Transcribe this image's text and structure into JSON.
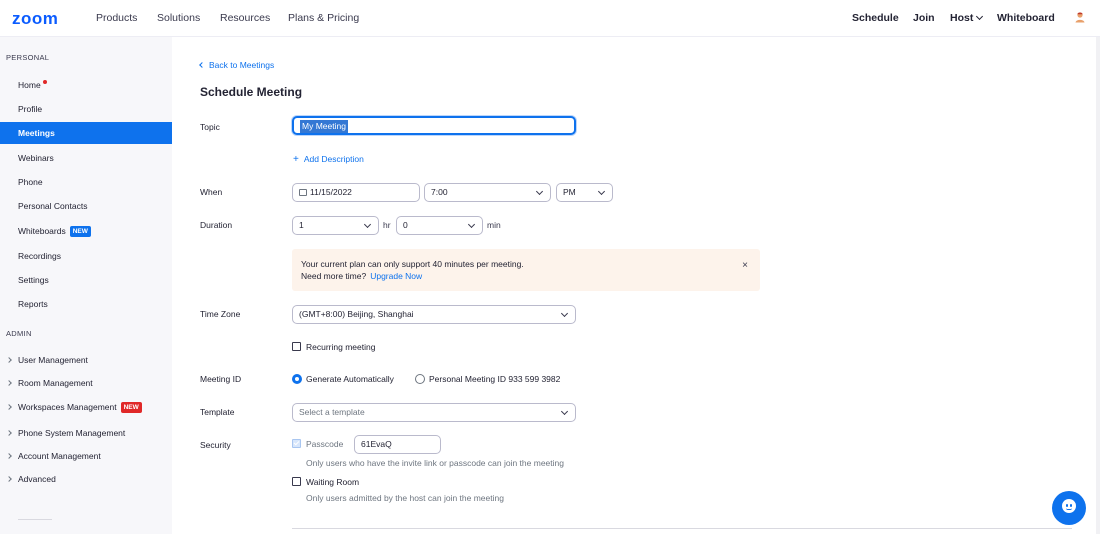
{
  "brand": {
    "logo": "zoom",
    "accent": "#0e72ed"
  },
  "topnav": {
    "links": [
      "Products",
      "Solutions",
      "Resources",
      "Plans & Pricing"
    ],
    "right": {
      "schedule": "Schedule",
      "join": "Join",
      "host": "Host",
      "whiteboard": "Whiteboard"
    }
  },
  "sidebar": {
    "personal_title": "PERSONAL",
    "items": [
      {
        "label": "Home",
        "dot": true
      },
      {
        "label": "Profile"
      },
      {
        "label": "Meetings",
        "active": true
      },
      {
        "label": "Webinars"
      },
      {
        "label": "Phone"
      },
      {
        "label": "Personal Contacts"
      },
      {
        "label": "Whiteboards",
        "badge": "NEW"
      },
      {
        "label": "Recordings"
      },
      {
        "label": "Settings"
      },
      {
        "label": "Reports"
      }
    ],
    "admin_title": "ADMIN",
    "admin_items": [
      {
        "label": "User Management"
      },
      {
        "label": "Room Management"
      },
      {
        "label": "Workspaces Management",
        "badge": "NEW"
      },
      {
        "label": "Phone System Management"
      },
      {
        "label": "Account Management"
      },
      {
        "label": "Advanced"
      }
    ]
  },
  "main": {
    "back_link": "Back to Meetings",
    "title": "Schedule Meeting",
    "topic": {
      "label": "Topic",
      "value": "My Meeting"
    },
    "add_description": "Add Description",
    "when": {
      "label": "When",
      "date": "11/15/2022",
      "time": "7:00",
      "ampm": "PM"
    },
    "duration": {
      "label": "Duration",
      "hours": "1",
      "hr_unit": "hr",
      "minutes": "0",
      "min_unit": "min"
    },
    "notice": {
      "line1": "Your current plan can only support 40 minutes per meeting.",
      "line2": "Need more time?",
      "upgrade": "Upgrade Now",
      "close": "×"
    },
    "timezone": {
      "label": "Time Zone",
      "value": "(GMT+8:00) Beijing, Shanghai"
    },
    "recurring": {
      "label": "Recurring meeting",
      "checked": false
    },
    "meeting_id": {
      "label": "Meeting ID",
      "option_auto": "Generate Automatically",
      "option_personal": "Personal Meeting ID 933 599 3982",
      "selected": "auto"
    },
    "template": {
      "label": "Template",
      "placeholder": "Select a template"
    },
    "security": {
      "label": "Security",
      "passcode_label": "Passcode",
      "passcode_value": "61EvaQ",
      "passcode_help": "Only users who have the invite link or passcode can join the meeting",
      "waiting_room_label": "Waiting Room",
      "waiting_room_help": "Only users admitted by the host can join the meeting"
    }
  },
  "icons": {
    "chat": "chatbot-icon",
    "calendar": "calendar-icon",
    "chevron": "chevron-down-icon"
  }
}
